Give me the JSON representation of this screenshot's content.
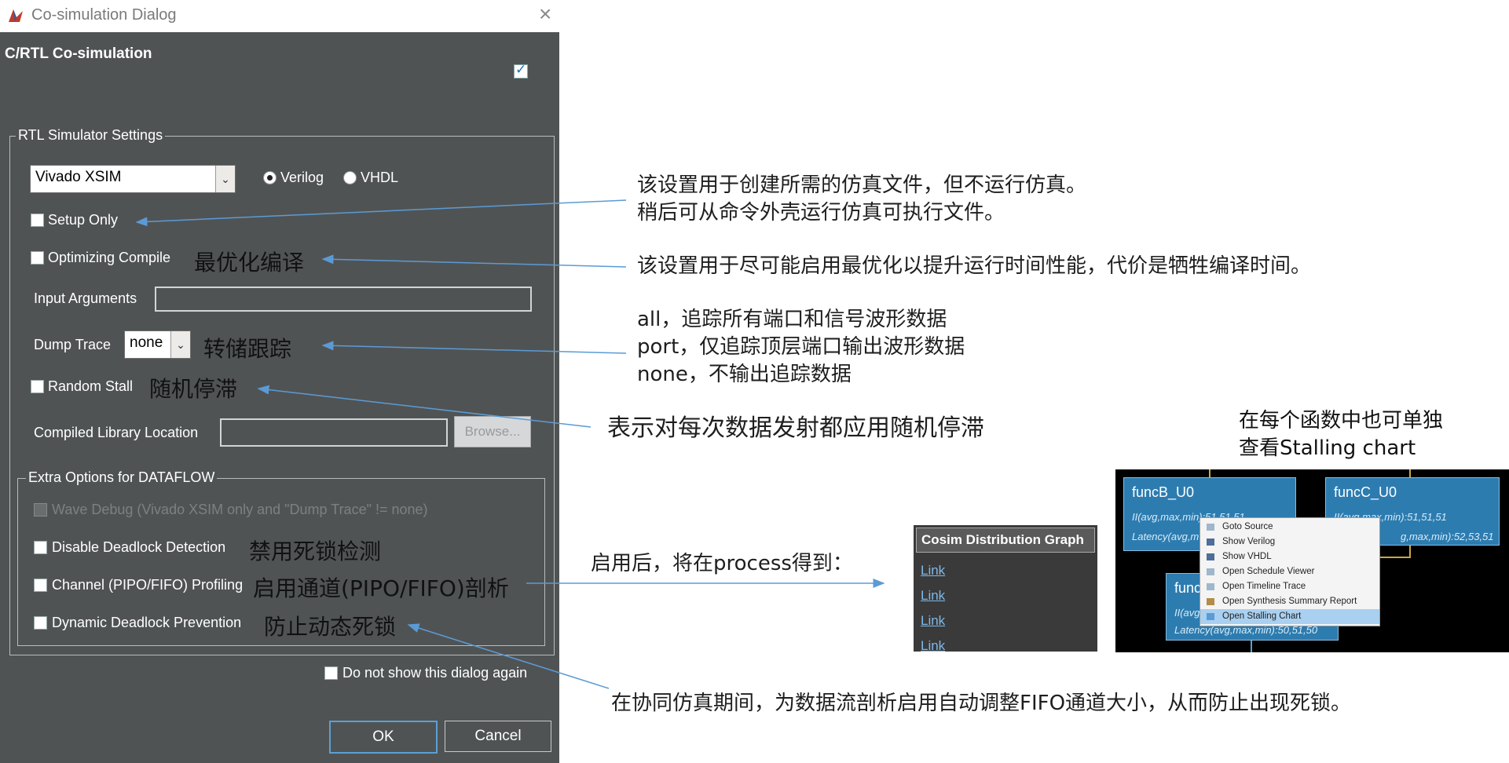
{
  "window": {
    "title": "Co-simulation Dialog",
    "header": "C/RTL Co-simulation"
  },
  "rtl": {
    "legend": "RTL Simulator Settings",
    "simulator": "Vivado XSIM",
    "lang_verilog": "Verilog",
    "lang_vhdl": "VHDL",
    "lang_selected": "Verilog",
    "setup_only": "Setup Only",
    "optimizing_compile": "Optimizing Compile",
    "input_arguments": "Input Arguments",
    "dump_trace": "Dump Trace",
    "dump_trace_value": "none",
    "random_stall": "Random Stall",
    "compiled_library": "Compiled Library Location",
    "browse": "Browse..."
  },
  "dataflow": {
    "legend": "Extra Options for DATAFLOW",
    "wave_debug": "Wave Debug (Vivado XSIM only and \"Dump Trace\" != none)",
    "disable_deadlock": "Disable Deadlock Detection",
    "channel_profiling": "Channel (PIPO/FIFO) Profiling",
    "dynamic_deadlock": "Dynamic Deadlock Prevention"
  },
  "footer": {
    "do_not_show": "Do not show this dialog again",
    "ok": "OK",
    "cancel": "Cancel"
  },
  "inline_cn": {
    "optimizing": "最优化编译",
    "dump": "转储跟踪",
    "random": "随机停滞",
    "disable": "禁用死锁检测",
    "channel": "启用通道(PIPO/FIFO)剖析",
    "dynamic": "防止动态死锁"
  },
  "notes": {
    "setup_1": "该设置用于创建所需的仿真文件，但不运行仿真。",
    "setup_2": "稍后可从命令外壳运行仿真可执行文件。",
    "optimizing": "该设置用于尽可能启用最优化以提升运行时间性能，代价是牺牲编译时间。",
    "dump_1": "all，追踪所有端口和信号波形数据",
    "dump_2": "port，仅追踪顶层端口输出波形数据",
    "dump_3": "none，不输出追踪数据",
    "random": "表示对每次数据发射都应用随机停滞",
    "channel": "启用后，将在process得到：",
    "dynamic": "在协同仿真期间，为数据流剖析启用自动调整FIFO通道大小，从而防止出现死锁。",
    "stalling_1": "在每个函数中也可单独",
    "stalling_2": "查看Stalling chart"
  },
  "cosim_graph": {
    "title": "Cosim Distribution Graph",
    "links": [
      "Link",
      "Link",
      "Link",
      "Link"
    ]
  },
  "dataflow_view": {
    "nodes": [
      {
        "name": "funcB_U0",
        "ii": "II(avg,max,min):51,51,51",
        "latency": "Latency(avg,m"
      },
      {
        "name": "funcC_U0",
        "ii": "II(avg,max,min):51,51,51",
        "latency": "g,max,min):52,53,51"
      },
      {
        "name": "func",
        "ii": "II(avg",
        "latency": "Latency(avg,max,min):50,51,50"
      }
    ],
    "menu": [
      "Goto Source",
      "Show Verilog",
      "Show VHDL",
      "Open Schedule Viewer",
      "Open Timeline Trace",
      "Open Synthesis Summary Report",
      "Open Stalling Chart"
    ],
    "menu_selected": "Open Stalling Chart"
  },
  "colors": {
    "dialog_bg": "#505354",
    "accent": "#5ba0d6",
    "arrow": "#5b9bd5",
    "node": "#2d7cb0"
  }
}
